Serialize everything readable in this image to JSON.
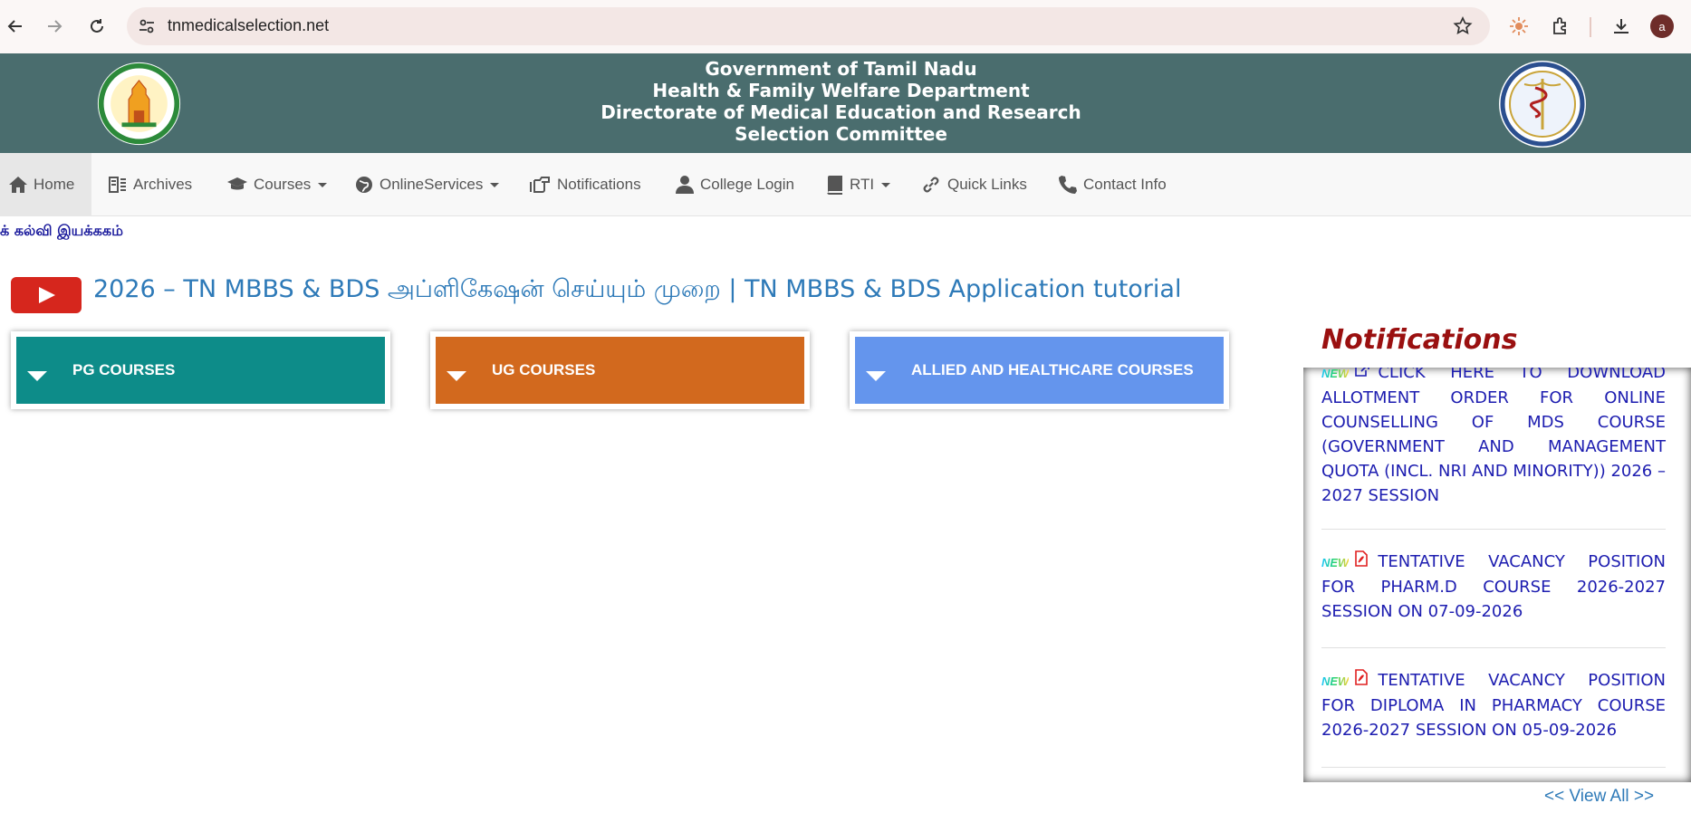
{
  "browser": {
    "url": "tnmedicalselection.net",
    "profile_initial": "a"
  },
  "header": {
    "line1": "Government of Tamil Nadu",
    "line2": "Health & Family Welfare Department",
    "line3": "Directorate of Medical Education and Research",
    "line4": "Selection Committee"
  },
  "nav": {
    "items": [
      {
        "label": "Home"
      },
      {
        "label": "Archives"
      },
      {
        "label": "Courses"
      },
      {
        "label": "OnlineServices"
      },
      {
        "label": "Notifications"
      },
      {
        "label": "College Login"
      },
      {
        "label": "RTI"
      },
      {
        "label": "Quick Links"
      },
      {
        "label": "Contact Info"
      }
    ]
  },
  "marquee": "க் கல்வி இயக்ககம்",
  "video": {
    "title": "2026 – TN MBBS & BDS அப்ளிகேஷன் செய்யும் முறை | TN MBBS & BDS Application tutorial"
  },
  "courses": [
    {
      "label": "PG COURSES",
      "color": "#0d8c89"
    },
    {
      "label": "UG COURSES",
      "color": "#d2691e"
    },
    {
      "label": "ALLIED AND HEALTHCARE COURSES",
      "color": "#6495ed"
    }
  ],
  "notifications": {
    "title": "Notifications",
    "badge": "NEW",
    "items": [
      {
        "text": "CLICK HERE TO DOWNLOAD ALLOTMENT ORDER FOR ONLINE COUNSELLING OF MDS COURSE (GOVERNMENT AND MANAGEMENT QUOTA (INCL. NRI AND MINORITY)) 2026 – 2027 SESSION",
        "icon": "external-link-icon"
      },
      {
        "text": "TENTATIVE VACANCY POSITION FOR PHARM.D COURSE 2026-2027 SESSION ON 07-09-2026",
        "icon": "pdf-icon"
      },
      {
        "text": "TENTATIVE VACANCY POSITION FOR DIPLOMA IN PHARMACY COURSE 2026-2027 SESSION ON 05-09-2026",
        "icon": "pdf-icon"
      }
    ],
    "view_all": "<< View All >>"
  }
}
